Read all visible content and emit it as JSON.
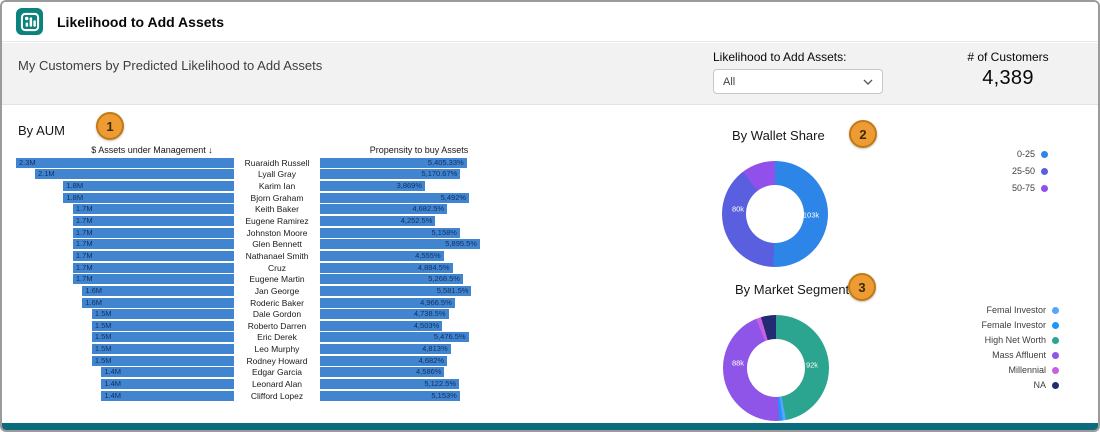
{
  "header": {
    "title": "Likelihood to Add Assets"
  },
  "toolbar": {
    "subtitle": "My Customers by Predicted Likelihood to Add Assets",
    "filter_label": "Likelihood to Add Assets:",
    "filter_value": "All",
    "customers_label": "# of Customers",
    "customers_count": "4,389"
  },
  "colors": {
    "bar_fill": "#4184d0",
    "bar_text": "#10305e",
    "accent_badge": "#ee9b33",
    "footer": "#0c6b7c",
    "app_icon": "#0b827c"
  },
  "chart_data": [
    {
      "id": "aum",
      "type": "bar",
      "title": "By AUM",
      "badge": "1",
      "columns": {
        "aum": "$ Assets under Management ↓",
        "propensity": "Propensity to buy Assets"
      },
      "rows": [
        {
          "name": "Ruaraidh Russell",
          "aum_label": "2.3M",
          "aum_m": 2.3,
          "prop_label": "5,405.33%",
          "prop": 5405.33
        },
        {
          "name": "Lyall Gray",
          "aum_label": "2.1M",
          "aum_m": 2.1,
          "prop_label": "5,170.67%",
          "prop": 5170.67
        },
        {
          "name": "Karim Ian",
          "aum_label": "1.8M",
          "aum_m": 1.8,
          "prop_label": "3,869%",
          "prop": 3869
        },
        {
          "name": "Bjorn Graham",
          "aum_label": "1.8M",
          "aum_m": 1.8,
          "prop_label": "5,492%",
          "prop": 5492
        },
        {
          "name": "Keith Baker",
          "aum_label": "1.7M",
          "aum_m": 1.7,
          "prop_label": "4,682.5%",
          "prop": 4682.5
        },
        {
          "name": "Eugene Ramirez",
          "aum_label": "1.7M",
          "aum_m": 1.7,
          "prop_label": "4,252.5%",
          "prop": 4252.5
        },
        {
          "name": "Johnston Moore",
          "aum_label": "1.7M",
          "aum_m": 1.7,
          "prop_label": "5,158%",
          "prop": 5158
        },
        {
          "name": "Glen Bennett",
          "aum_label": "1.7M",
          "aum_m": 1.7,
          "prop_label": "5,895.5%",
          "prop": 5895.5
        },
        {
          "name": "Nathanael Smith",
          "aum_label": "1.7M",
          "aum_m": 1.7,
          "prop_label": "4,555%",
          "prop": 4555
        },
        {
          "name": "Cruz",
          "aum_label": "1.7M",
          "aum_m": 1.7,
          "prop_label": "4,884.5%",
          "prop": 4884.5
        },
        {
          "name": "Eugene Martin",
          "aum_label": "1.7M",
          "aum_m": 1.7,
          "prop_label": "5,268.5%",
          "prop": 5268.5
        },
        {
          "name": "Jan George",
          "aum_label": "1.6M",
          "aum_m": 1.6,
          "prop_label": "5,581.5%",
          "prop": 5581.5
        },
        {
          "name": "Roderic Baker",
          "aum_label": "1.6M",
          "aum_m": 1.6,
          "prop_label": "4,966.5%",
          "prop": 4966.5
        },
        {
          "name": "Dale Gordon",
          "aum_label": "1.5M",
          "aum_m": 1.5,
          "prop_label": "4,738.5%",
          "prop": 4738.5
        },
        {
          "name": "Roberto Darren",
          "aum_label": "1.5M",
          "aum_m": 1.5,
          "prop_label": "4,503%",
          "prop": 4503
        },
        {
          "name": "Eric Derek",
          "aum_label": "1.5M",
          "aum_m": 1.5,
          "prop_label": "5,476.5%",
          "prop": 5476.5
        },
        {
          "name": "Leo Murphy",
          "aum_label": "1.5M",
          "aum_m": 1.5,
          "prop_label": "4,813%",
          "prop": 4813
        },
        {
          "name": "Rodney Howard",
          "aum_label": "1.5M",
          "aum_m": 1.5,
          "prop_label": "4,682%",
          "prop": 4682
        },
        {
          "name": "Edgar Garcia",
          "aum_label": "1.4M",
          "aum_m": 1.4,
          "prop_label": "4,586%",
          "prop": 4586
        },
        {
          "name": "Leonard Alan",
          "aum_label": "1.4M",
          "aum_m": 1.4,
          "prop_label": "5,122.5%",
          "prop": 5122.5
        },
        {
          "name": "Clifford Lopez",
          "aum_label": "1.4M",
          "aum_m": 1.4,
          "prop_label": "5,153%",
          "prop": 5153
        }
      ]
    },
    {
      "id": "wallet_share",
      "type": "donut",
      "title": "By Wallet Share",
      "badge": "2",
      "segments": [
        {
          "label": "0-25",
          "value_k": 103,
          "display": "103k",
          "color": "#2e85e8"
        },
        {
          "label": "25-50",
          "value_k": 80,
          "display": "80k",
          "color": "#5a5fe0"
        },
        {
          "label": "50-75",
          "value_k": 21,
          "display": "",
          "color": "#9050e9"
        }
      ],
      "legend": [
        {
          "label": "0-25",
          "color": "#2e85e8"
        },
        {
          "label": "25-50",
          "color": "#5a5fe0"
        },
        {
          "label": "50-75",
          "color": "#9050e9"
        }
      ]
    },
    {
      "id": "market_segment",
      "type": "donut",
      "title": "By Market Segment",
      "badge": "3",
      "segments": [
        {
          "label": "High Net Worth",
          "value_k": 92,
          "display": "92k",
          "color": "#2ba58f"
        },
        {
          "label": "Femal Investor",
          "value_k": 2,
          "display": "",
          "color": "#57a3fd"
        },
        {
          "label": "Female Investor",
          "value_k": 2,
          "display": "",
          "color": "#1b96ff"
        },
        {
          "label": "Mass Affluent",
          "value_k": 88,
          "display": "88k",
          "color": "#8f54e8"
        },
        {
          "label": "Millennial",
          "value_k": 3,
          "display": "",
          "color": "#c661e3"
        },
        {
          "label": "NA",
          "value_k": 9,
          "display": "",
          "color": "#232c72"
        }
      ],
      "legend": [
        {
          "label": "Femal Investor",
          "color": "#57a3fd"
        },
        {
          "label": "Female Investor",
          "color": "#1b96ff"
        },
        {
          "label": "High Net Worth",
          "color": "#2ba58f"
        },
        {
          "label": "Mass Affluent",
          "color": "#8f54e8"
        },
        {
          "label": "Millennial",
          "color": "#c661e3"
        },
        {
          "label": "NA",
          "color": "#232c72"
        }
      ]
    }
  ]
}
